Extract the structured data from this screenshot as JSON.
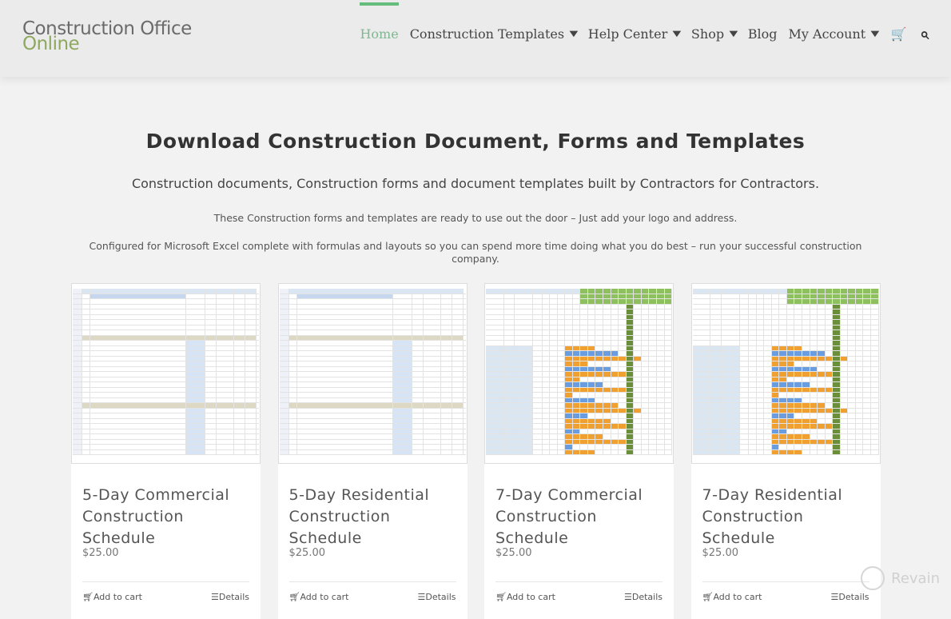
{
  "header": {
    "logo_line1": "Construction Office",
    "logo_line2": "Online",
    "nav": [
      {
        "label": "Home",
        "active": true,
        "dropdown": false
      },
      {
        "label": "Construction Templates",
        "dropdown": true
      },
      {
        "label": "Help Center",
        "dropdown": true
      },
      {
        "label": "Shop",
        "dropdown": true
      },
      {
        "label": "Blog",
        "dropdown": false
      },
      {
        "label": "My Account",
        "dropdown": true
      }
    ],
    "cart_icon": "cart-icon",
    "search_icon": "search-icon"
  },
  "main": {
    "title": "Download Construction Document, Forms and Templates",
    "subtitle": "Construction documents, Construction forms and document templates built by Contractors for Contractors.",
    "para1": "These Construction forms and templates are ready to use out the door –  Just add your logo and address.",
    "para2": "Configured for Microsoft Excel complete with formulas and layouts so you can spend more time doing what you do best – run your successful construction company."
  },
  "products": [
    {
      "name": "5-Day Commercial Construction Schedule",
      "price": "$25.00",
      "add_to_cart": "Add to cart",
      "details": "Details",
      "style": "table"
    },
    {
      "name": "5-Day Residential Construction Schedule",
      "price": "$25.00",
      "add_to_cart": "Add to cart",
      "details": "Details",
      "style": "table"
    },
    {
      "name": "7-Day Commercial Construction Schedule",
      "price": "$25.00",
      "add_to_cart": "Add to cart",
      "details": "Details",
      "style": "gantt"
    },
    {
      "name": "7-Day Residential Construction Schedule",
      "price": "$25.00",
      "add_to_cart": "Add to cart",
      "details": "Details",
      "style": "gantt"
    }
  ],
  "watermark": "Revain",
  "colors": {
    "accent": "#65bd7d",
    "logo_green": "#8fa860"
  }
}
